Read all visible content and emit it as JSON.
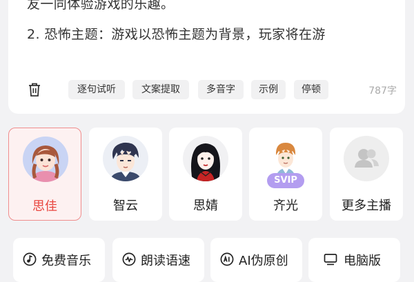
{
  "editor": {
    "line1": "友一同体验游戏的乐趣。",
    "line2": "2. 恐怖主题：游戏以恐怖主题为背景，玩家将在游",
    "tools": [
      "逐句试听",
      "文案提取",
      "多音字",
      "示例",
      "停顿"
    ],
    "char_count": "787字"
  },
  "voices": [
    {
      "name": "思佳",
      "selected": true
    },
    {
      "name": "智云",
      "selected": false
    },
    {
      "name": "思婧",
      "selected": false
    },
    {
      "name": "齐光",
      "badge": "SVIP",
      "selected": false
    },
    {
      "name": "更多主播",
      "selected": false
    }
  ],
  "functions": [
    {
      "label": "免费音乐",
      "icon": "music-note-icon"
    },
    {
      "label": "朗读语速",
      "icon": "waveform-icon"
    },
    {
      "label": "AI伪原创",
      "icon": "ai-icon"
    },
    {
      "label": "电脑版",
      "icon": "monitor-icon"
    }
  ],
  "colors": {
    "accent": "#e9463f",
    "svip": "#b39df0",
    "background": "#f2f2f4"
  }
}
